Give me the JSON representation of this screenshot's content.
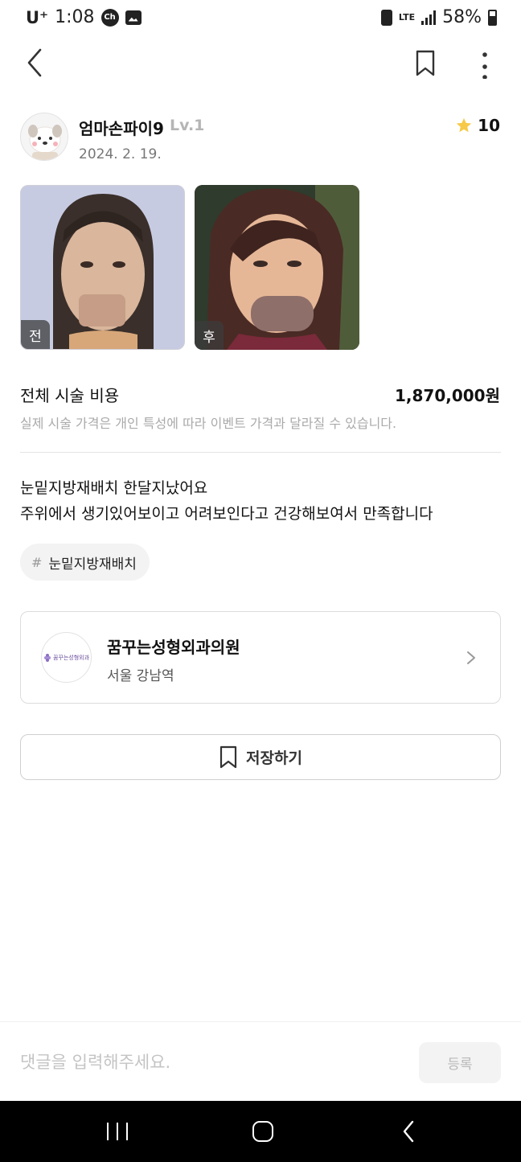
{
  "status_bar": {
    "carrier": "U⁺",
    "time": "1:08",
    "chat_badge": "Ch",
    "network": "LTE",
    "battery": "58%"
  },
  "icons": {
    "back": "chevron-left-icon",
    "bookmark": "bookmark-icon",
    "more": "more-vertical-icon",
    "star": "star-icon",
    "clinic_arrow": "chevron-right-icon"
  },
  "author": {
    "name": "엄마손파이9",
    "level": "Lv.1",
    "date": "2024. 2. 19."
  },
  "rating": {
    "value": "10"
  },
  "photos": {
    "before_label": "전",
    "after_label": "후"
  },
  "cost": {
    "label": "전체 시술 비용",
    "value": "1,870,000원",
    "note": "실제 시술 가격은 개인 특성에 따라 이벤트 가격과 달라질 수 있습니다."
  },
  "review": {
    "line1": "눈밑지방재배치 한달지났어요",
    "line2": "주위에서 생기있어보이고 어려보인다고 건강해보여서 만족합니다"
  },
  "tag": {
    "hash": "#",
    "text": "눈밑지방재배치"
  },
  "clinic": {
    "name": "꿈꾸는성형외과의원",
    "location": "서울 강남역",
    "logo_text": "꿈꾸는성형외과"
  },
  "save_button": {
    "label": "저장하기"
  },
  "comment": {
    "placeholder": "댓글을 입력해주세요.",
    "submit_label": "등록"
  },
  "colors": {
    "star": "#F7C948",
    "accent_text": "#111111",
    "muted": "#AAAAAA",
    "android_nav": "#000000"
  }
}
